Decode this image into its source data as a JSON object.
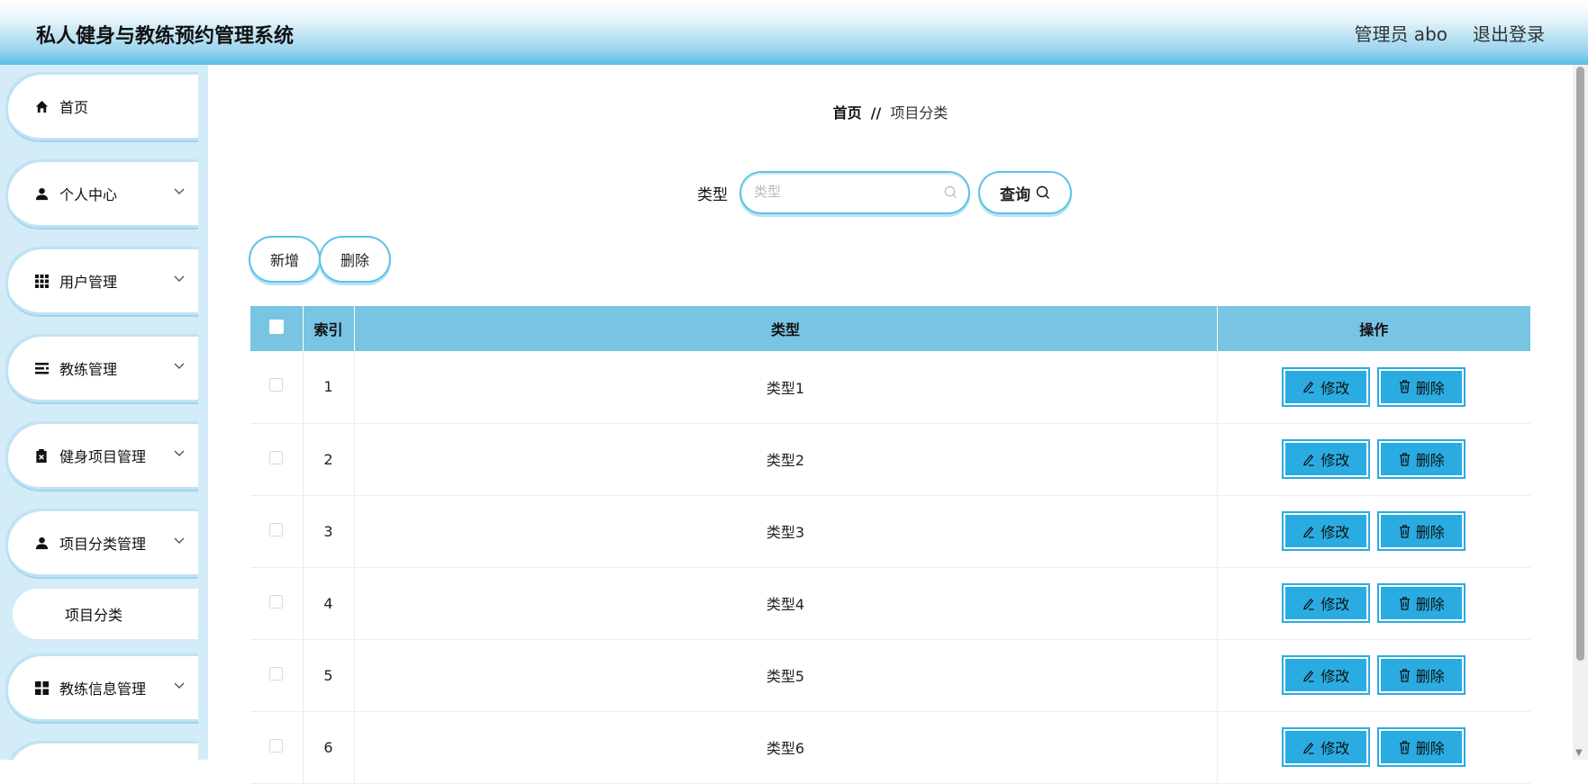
{
  "header": {
    "title": "私人健身与教练预约管理系统",
    "user": "管理员 abo",
    "logout": "退出登录"
  },
  "sidebar": {
    "items": [
      {
        "label": "首页",
        "icon": "home-icon"
      },
      {
        "label": "个人中心",
        "icon": "user-icon"
      },
      {
        "label": "用户管理",
        "icon": "grid-icon"
      },
      {
        "label": "教练管理",
        "icon": "list-icon"
      },
      {
        "label": "健身项目管理",
        "icon": "clipboard-icon"
      },
      {
        "label": "项目分类管理",
        "icon": "user-icon"
      },
      {
        "label": "教练信息管理",
        "icon": "apps-icon"
      }
    ],
    "sub_item": "项目分类"
  },
  "breadcrumb": {
    "home": "首页",
    "sep": "//",
    "current": "项目分类"
  },
  "search": {
    "label": "类型",
    "placeholder": "类型",
    "button": "查询"
  },
  "actions": {
    "add": "新增",
    "delete": "删除"
  },
  "table": {
    "columns": [
      "索引",
      "类型",
      "操作"
    ],
    "rows": [
      {
        "index": "1",
        "type": "类型1"
      },
      {
        "index": "2",
        "type": "类型2"
      },
      {
        "index": "3",
        "type": "类型3"
      },
      {
        "index": "4",
        "type": "类型4"
      },
      {
        "index": "5",
        "type": "类型5"
      },
      {
        "index": "6",
        "type": "类型6"
      }
    ],
    "edit_label": "修改",
    "delete_label": "删除"
  },
  "colors": {
    "accent": "#2aace2",
    "table_header": "#78c4e3",
    "sidebar_bg": "#d3ecf7"
  }
}
